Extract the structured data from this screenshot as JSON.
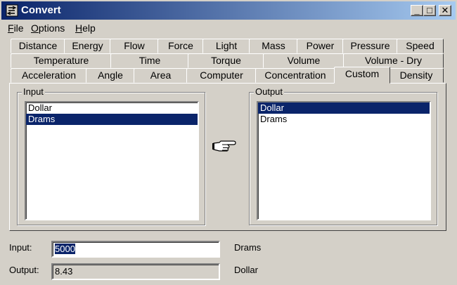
{
  "window": {
    "title": "Convert",
    "buttons": {
      "minimize": "_",
      "maximize": "□",
      "close": "✕"
    }
  },
  "menu": [
    {
      "label": "File",
      "mnemonic": "F",
      "rest": "ile"
    },
    {
      "label": "Options",
      "mnemonic": "O",
      "rest": "ptions"
    },
    {
      "label": "Help",
      "mnemonic": "H",
      "rest": "elp"
    }
  ],
  "tabs": {
    "row1": [
      "Distance",
      "Energy",
      "Flow",
      "Force",
      "Light",
      "Mass",
      "Power",
      "Pressure",
      "Speed"
    ],
    "row2": [
      "Temperature",
      "Time",
      "Torque",
      "Volume",
      "Volume - Dry"
    ],
    "row3": [
      "Acceleration",
      "Angle",
      "Area",
      "Computer",
      "Concentration",
      "Custom",
      "Density"
    ],
    "active": "Custom"
  },
  "input_group": {
    "label": "Input",
    "items": [
      "Dollar",
      "Drams"
    ],
    "selected_index": 1
  },
  "output_group": {
    "label": "Output",
    "items": [
      "Dollar",
      "Drams"
    ],
    "selected_index": 0
  },
  "icons": {
    "convert_arrow": "pointing-hand-icon"
  },
  "fields": {
    "input_label": "Input:",
    "input_value": "5000",
    "input_unit": "Drams",
    "output_label": "Output:",
    "output_value": "8.43",
    "output_unit": "Dollar"
  },
  "colors": {
    "titlebar_start": "#0a246a",
    "titlebar_end": "#a6caf0",
    "selection": "#0a246a",
    "face": "#d4d0c8"
  }
}
